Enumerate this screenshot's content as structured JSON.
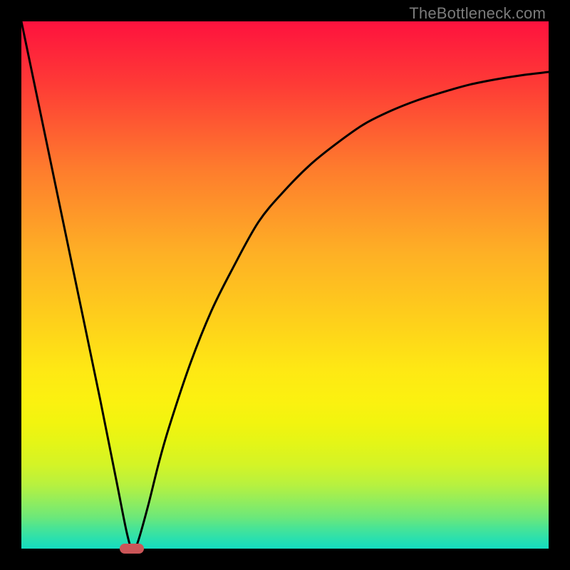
{
  "watermark": "TheBottleneck.com",
  "colors": {
    "frame": "#000000",
    "curve": "#000000",
    "marker": "#cb5658",
    "watermark": "#7b7b7b"
  },
  "chart_data": {
    "type": "line",
    "title": "",
    "xlabel": "",
    "ylabel": "",
    "xlim": [
      0,
      100
    ],
    "ylim": [
      0,
      100
    ],
    "grid": false,
    "legend": false,
    "series": [
      {
        "name": "bottleneck-curve",
        "x": [
          0,
          5,
          10,
          15,
          18,
          20,
          21,
          22,
          24,
          26,
          28,
          32,
          36,
          40,
          45,
          50,
          55,
          60,
          65,
          70,
          75,
          80,
          85,
          90,
          95,
          100
        ],
        "values": [
          100,
          76,
          52,
          28,
          13,
          3,
          0,
          1,
          8,
          16,
          23,
          35,
          45,
          53,
          62,
          68,
          73,
          77,
          80.5,
          83,
          85,
          86.6,
          88,
          89,
          89.8,
          90.4
        ]
      }
    ],
    "annotations": [
      {
        "name": "minimum-marker",
        "x": 21,
        "y": 0,
        "shape": "pill"
      }
    ],
    "background_gradient": {
      "direction": "vertical",
      "stops": [
        {
          "pos": 0,
          "color": "#fe123e"
        },
        {
          "pos": 50,
          "color": "#feb824"
        },
        {
          "pos": 75,
          "color": "#f2f40f"
        },
        {
          "pos": 100,
          "color": "#14dcc0"
        }
      ]
    }
  }
}
